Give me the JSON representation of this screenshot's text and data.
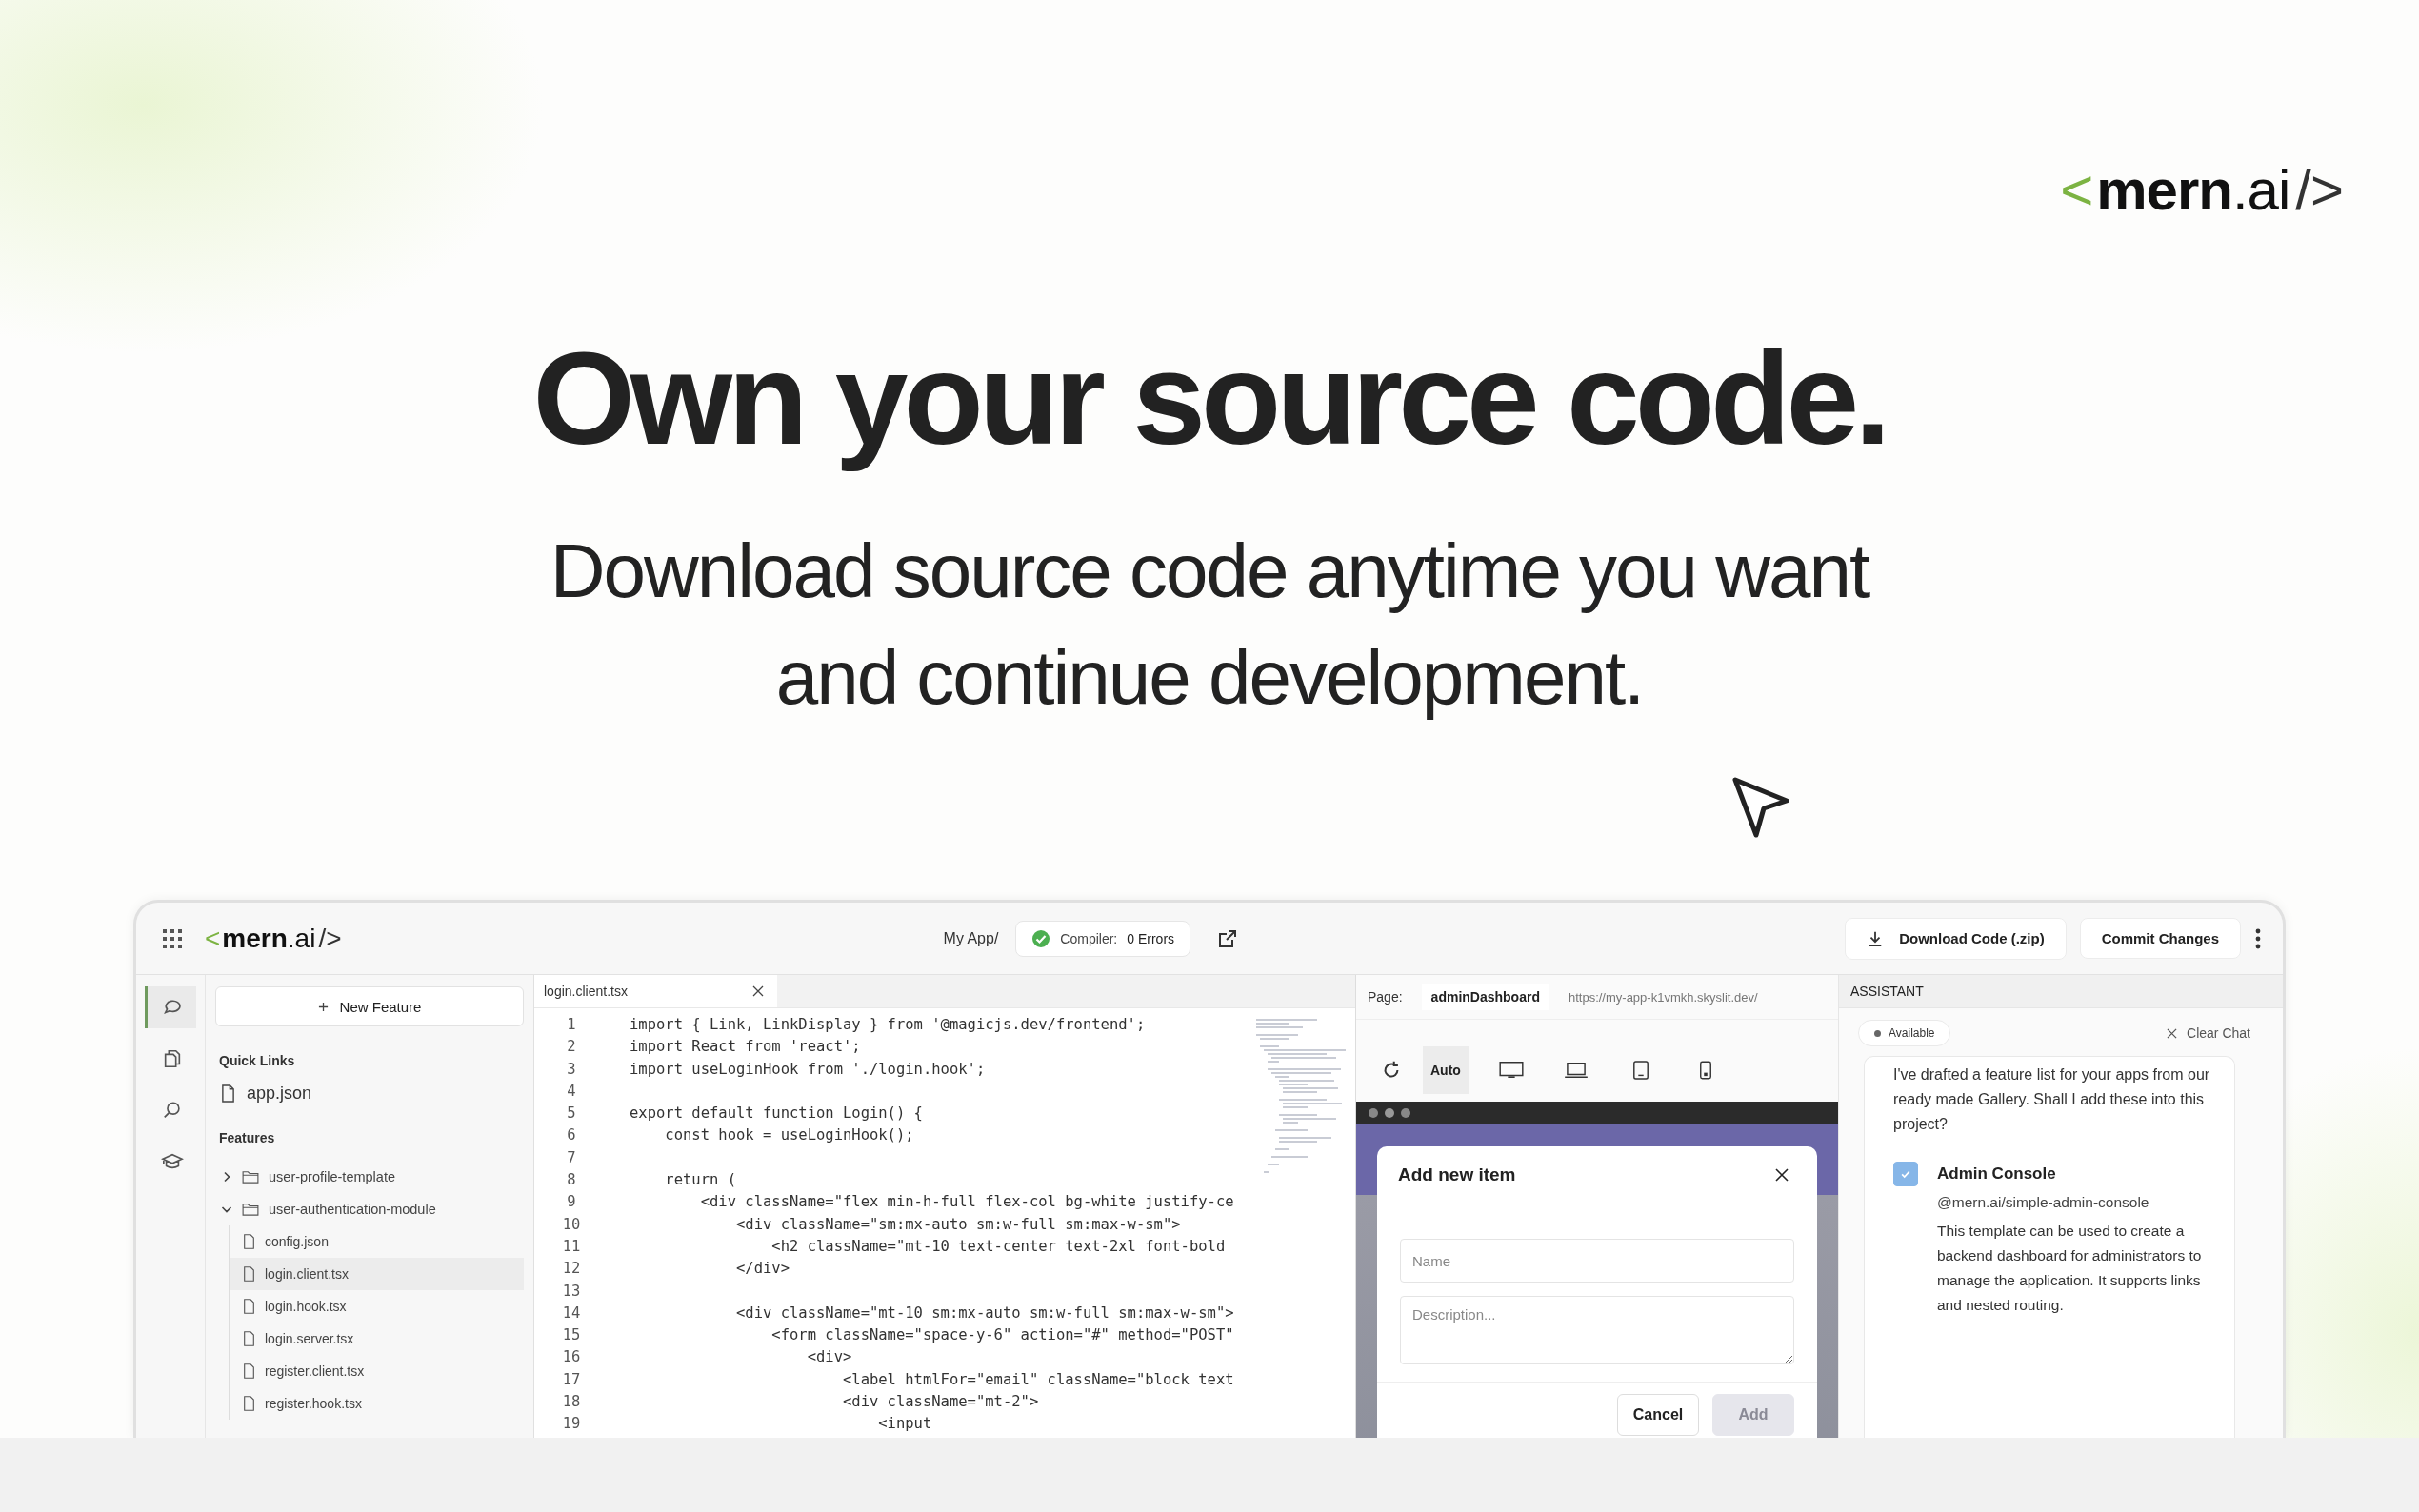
{
  "brand_logo": {
    "open": "<",
    "name": "mern",
    "domain": ".ai",
    "close": "/>"
  },
  "headline": "Own your source code.",
  "subheadline": [
    "Download source code anytime you want",
    "and continue development."
  ],
  "app": {
    "topbar": {
      "logo": {
        "open": "<",
        "name": "mern",
        "domain": ".ai",
        "close": "/>"
      },
      "project": "My App/",
      "compiler": {
        "label": "Compiler:",
        "status": "0 Errors",
        "ok": true
      },
      "actions": [
        {
          "label": "Download Code (.zip)",
          "kind": "download"
        },
        {
          "label": "Commit Changes",
          "kind": "plain"
        }
      ]
    },
    "activity_bar": [
      {
        "kind": "chat",
        "selected": true
      },
      {
        "kind": "files",
        "selected": false
      },
      {
        "kind": "search",
        "selected": false
      },
      {
        "kind": "learn",
        "selected": false
      }
    ],
    "sidebar": {
      "new_button": "New Feature",
      "quick_links_heading": "Quick Links",
      "quick_links": [
        "app.json"
      ],
      "features_heading": "Features",
      "tree": [
        {
          "label": "user-profile-template",
          "kind": "folder",
          "expanded": false
        },
        {
          "label": "user-authentication-module",
          "kind": "folder",
          "expanded": true,
          "children": [
            {
              "label": "config.json",
              "kind": "file",
              "selected": false
            },
            {
              "label": "login.client.tsx",
              "kind": "file",
              "selected": true
            },
            {
              "label": "login.hook.tsx",
              "kind": "file",
              "selected": false
            },
            {
              "label": "login.server.tsx",
              "kind": "file",
              "selected": false
            },
            {
              "label": "register.client.tsx",
              "kind": "file",
              "selected": false
            },
            {
              "label": "register.hook.tsx",
              "kind": "file",
              "selected": false
            }
          ]
        }
      ]
    },
    "editor": {
      "tabs": [
        {
          "label": "login.client.tsx",
          "selected": true
        }
      ],
      "lines": [
        {
          "number": "1",
          "code": "import { Link, LinkDisplay } from '@magicjs.dev/frontend';"
        },
        {
          "number": "2",
          "code": "import React from 'react';"
        },
        {
          "number": "3",
          "code": "import useLoginHook from './login.hook';"
        },
        {
          "number": "4"
        },
        {
          "number": "5",
          "code": "export default function Login() {"
        },
        {
          "number": "6",
          "code": "    const hook = useLoginHook();"
        },
        {
          "number": "7"
        },
        {
          "number": "8",
          "code": "    return ("
        },
        {
          "number": "9",
          "code": "        <div className=\"flex min-h-full flex-col bg-white justify-ce"
        },
        {
          "number": "10",
          "code": "            <div className=\"sm:mx-auto sm:w-full sm:max-w-sm\">"
        },
        {
          "number": "11",
          "code": "                <h2 className=\"mt-10 text-center text-2xl font-bold"
        },
        {
          "number": "12",
          "code": "            </div>"
        },
        {
          "number": "13"
        },
        {
          "number": "14",
          "code": "            <div className=\"mt-10 sm:mx-auto sm:w-full sm:max-w-sm\">"
        },
        {
          "number": "15",
          "code": "                <form className=\"space-y-6\" action=\"#\" method=\"POST\""
        },
        {
          "number": "16",
          "code": "                    <div>"
        },
        {
          "number": "17",
          "code": "                        <label htmlFor=\"email\" className=\"block text"
        },
        {
          "number": "18",
          "code": "                        <div className=\"mt-2\">"
        },
        {
          "number": "19",
          "code": "                            <input"
        }
      ]
    },
    "preview": {
      "page_label": "Page:",
      "page": "adminDashboard",
      "url": "https://my-app-k1vmkh.skyslit.dev/",
      "view_modes": [
        {
          "kind": "text",
          "label": "Auto",
          "selected": true
        },
        {
          "kind": "desktop",
          "selected": false
        },
        {
          "kind": "laptop",
          "selected": false
        },
        {
          "kind": "tablet",
          "selected": false
        },
        {
          "kind": "phone",
          "selected": false
        }
      ],
      "dialog": {
        "title": "Add new item",
        "fields": [
          {
            "kind": "input",
            "placeholder": "Name"
          },
          {
            "kind": "textarea",
            "placeholder": "Description..."
          }
        ],
        "buttons": [
          {
            "label": "Cancel",
            "disabled": false
          },
          {
            "label": "Add",
            "disabled": true
          }
        ]
      }
    },
    "assistant": {
      "title": "ASSISTANT",
      "status": "Available",
      "clear_button": "Clear Chat",
      "message": "I've drafted a feature list for your apps from our ready made Gallery. Shall I add these into this project?",
      "suggestions": [
        {
          "title": "Admin Console",
          "package": "@mern.ai/simple-admin-console",
          "description": "This template can be used to create a backend dashboard for administrators to manage the application. It supports links and nested routing.",
          "checked": true
        }
      ]
    }
  }
}
